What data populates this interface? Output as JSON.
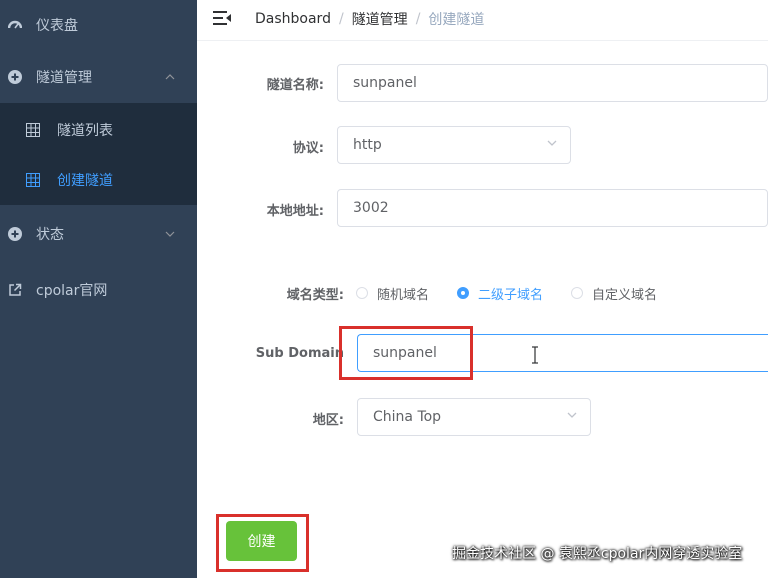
{
  "sidebar": {
    "items": [
      {
        "label": "仪表盘",
        "icon": "dashboard-icon"
      },
      {
        "label": "隧道管理",
        "icon": "plus-circle-icon"
      },
      {
        "label": "状态",
        "icon": "plus-circle-icon"
      },
      {
        "label": "cpolar官网",
        "icon": "external-link-icon"
      }
    ],
    "submenu": [
      {
        "label": "隧道列表",
        "icon": "grid-icon",
        "active": false
      },
      {
        "label": "创建隧道",
        "icon": "grid-icon",
        "active": true
      }
    ]
  },
  "header": {
    "breadcrumb": [
      "Dashboard",
      "隧道管理",
      "创建隧道"
    ]
  },
  "form": {
    "tunnel_name": {
      "label": "隧道名称:",
      "value": "sunpanel"
    },
    "protocol": {
      "label": "协议:",
      "value": "http"
    },
    "local_address": {
      "label": "本地地址:",
      "value": "3002"
    },
    "domain_type": {
      "label": "域名类型:",
      "options": [
        "随机域名",
        "二级子域名",
        "自定义域名"
      ],
      "selected": "二级子域名"
    },
    "sub_domain": {
      "label": "Sub Domain",
      "value": "sunpanel"
    },
    "region": {
      "label": "地区:",
      "value": "China Top"
    },
    "submit_label": "创建"
  },
  "watermark": "掘金技术社区 @ 袁熙丞cpolar内网穿透实验室",
  "colors": {
    "sidebar_bg": "#304156",
    "accent": "#409eff",
    "success": "#67c23a",
    "highlight": "#d9302b"
  }
}
